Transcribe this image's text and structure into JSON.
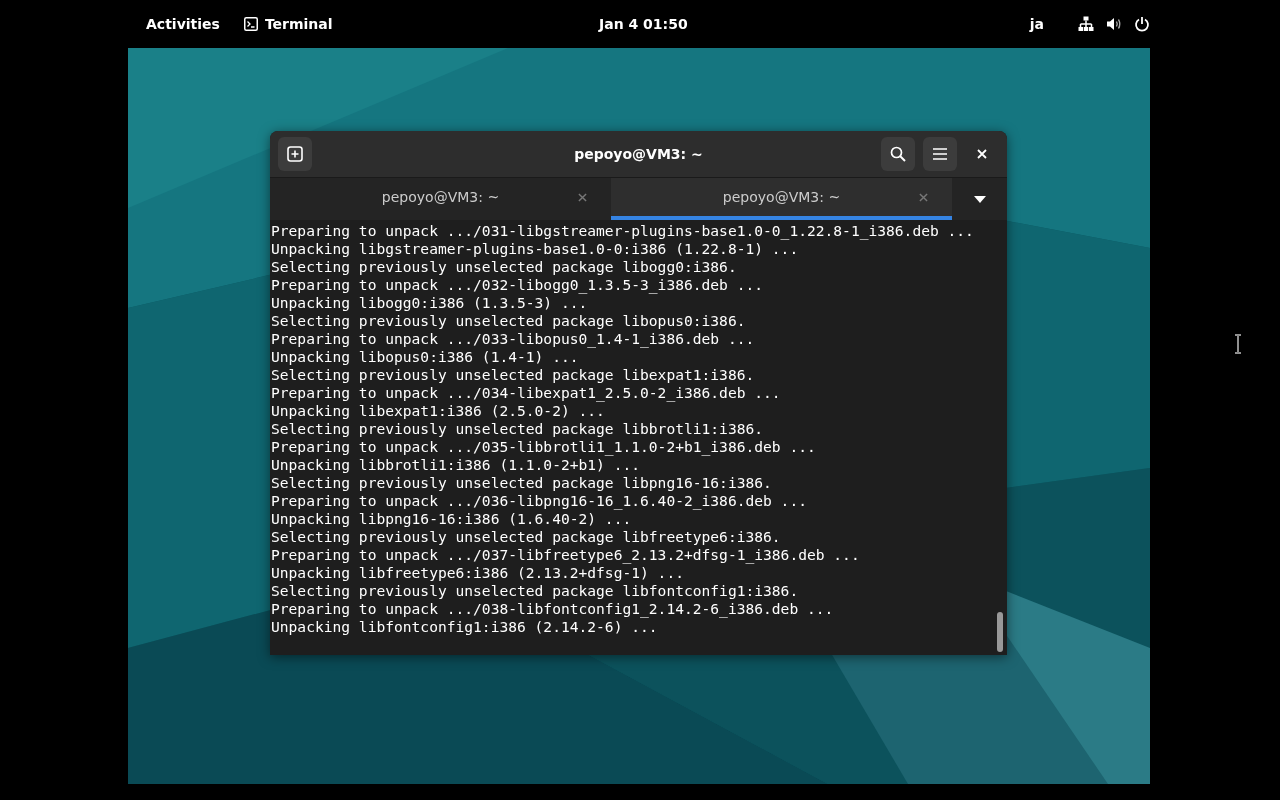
{
  "top_bar": {
    "activities": "Activities",
    "app": "Terminal",
    "clock": "Jan 4  01:50",
    "input_method": "ja"
  },
  "window": {
    "title": "pepoyo@VM3: ~"
  },
  "tabs": [
    {
      "label": "pepoyo@VM3: ~",
      "selected": false
    },
    {
      "label": "pepoyo@VM3: ~",
      "selected": true
    }
  ],
  "terminal_lines": [
    "Preparing to unpack .../031-libgstreamer-plugins-base1.0-0_1.22.8-1_i386.deb ...",
    "Unpacking libgstreamer-plugins-base1.0-0:i386 (1.22.8-1) ...",
    "Selecting previously unselected package libogg0:i386.",
    "Preparing to unpack .../032-libogg0_1.3.5-3_i386.deb ...",
    "Unpacking libogg0:i386 (1.3.5-3) ...",
    "Selecting previously unselected package libopus0:i386.",
    "Preparing to unpack .../033-libopus0_1.4-1_i386.deb ...",
    "Unpacking libopus0:i386 (1.4-1) ...",
    "Selecting previously unselected package libexpat1:i386.",
    "Preparing to unpack .../034-libexpat1_2.5.0-2_i386.deb ...",
    "Unpacking libexpat1:i386 (2.5.0-2) ...",
    "Selecting previously unselected package libbrotli1:i386.",
    "Preparing to unpack .../035-libbrotli1_1.1.0-2+b1_i386.deb ...",
    "Unpacking libbrotli1:i386 (1.1.0-2+b1) ...",
    "Selecting previously unselected package libpng16-16:i386.",
    "Preparing to unpack .../036-libpng16-16_1.6.40-2_i386.deb ...",
    "Unpacking libpng16-16:i386 (1.6.40-2) ...",
    "Selecting previously unselected package libfreetype6:i386.",
    "Preparing to unpack .../037-libfreetype6_2.13.2+dfsg-1_i386.deb ...",
    "Unpacking libfreetype6:i386 (2.13.2+dfsg-1) ...",
    "Selecting previously unselected package libfontconfig1:i386.",
    "Preparing to unpack .../038-libfontconfig1_2.14.2-6_i386.deb ...",
    "Unpacking libfontconfig1:i386 (2.14.2-6) ..."
  ]
}
